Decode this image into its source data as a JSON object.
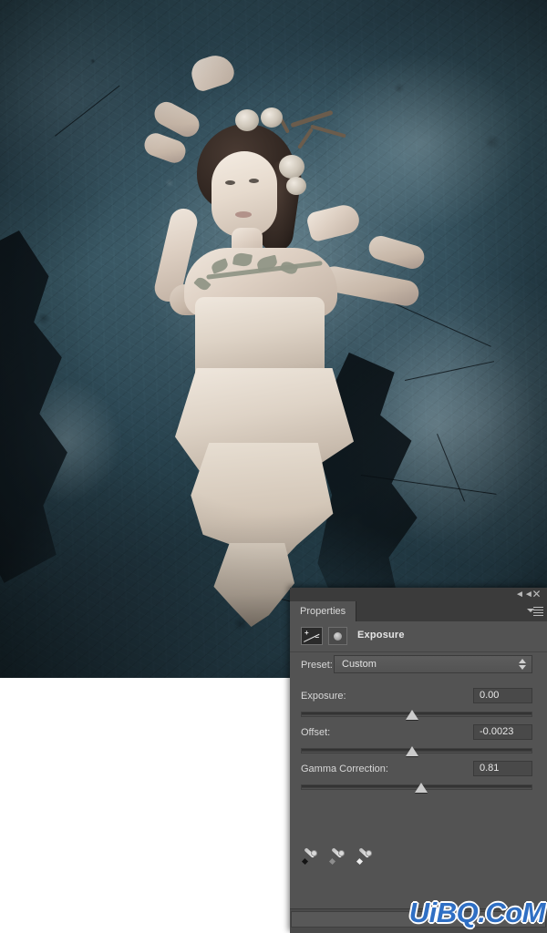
{
  "canvas": {
    "name": "document-canvas",
    "artwork_description": "Dark teal grunge wall with pale-dressed woman, floral headpiece"
  },
  "panel": {
    "tab_label": "Properties",
    "dock": {
      "collapse_icon": "collapse-double-left-icon",
      "close_icon": "close-icon",
      "menu_icon": "panel-menu-icon"
    },
    "adjustment": {
      "icon": "exposure-adjustment-icon",
      "mask_icon": "layer-mask-thumbnail-icon",
      "title": "Exposure"
    },
    "preset": {
      "label": "Preset:",
      "value": "Custom",
      "stepper_icon": "stepper-up-down-icon"
    },
    "sliders": [
      {
        "name": "exposure",
        "label": "Exposure:",
        "value": "0.00",
        "position_pct": 48
      },
      {
        "name": "offset",
        "label": "Offset:",
        "value": "-0.0023",
        "position_pct": 48
      },
      {
        "name": "gamma-correction",
        "label": "Gamma Correction:",
        "value": "0.81",
        "position_pct": 52
      }
    ],
    "eyedroppers": [
      {
        "name": "set-black-point-eyedropper",
        "icon": "eyedropper-black-icon",
        "tip_color": "#1a1a1a"
      },
      {
        "name": "set-gray-point-eyedropper",
        "icon": "eyedropper-gray-icon",
        "tip_color": "#8d8d8d"
      },
      {
        "name": "set-white-point-eyedropper",
        "icon": "eyedropper-white-icon",
        "tip_color": "#ededed"
      }
    ]
  },
  "watermark": {
    "text": "UiBQ.CoM",
    "color": "#2f6fc4",
    "outline_color": "#f2f2f2"
  },
  "colors": {
    "panel_bg": "#535353",
    "panel_chrome": "#3b3b3b",
    "text": "#d8d8d8",
    "field_bg": "#494949",
    "canvas_teal": "#2c4450"
  }
}
